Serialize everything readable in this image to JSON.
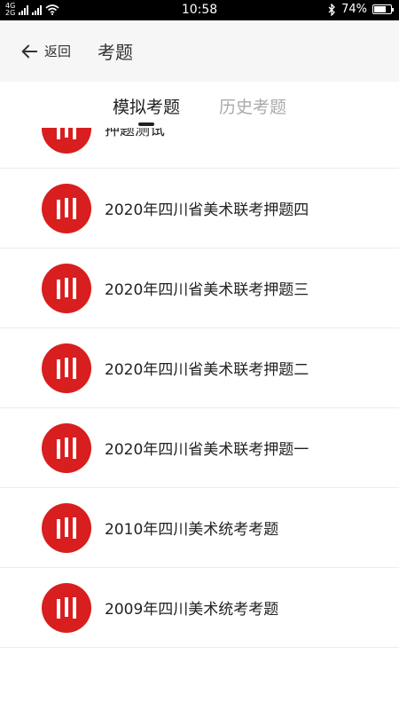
{
  "status": {
    "net_top": "4G",
    "net_bottom": "2G",
    "time": "10:58",
    "battery_text": "74%",
    "battery_level": 0.74
  },
  "header": {
    "back_label": "返回",
    "title": "考题"
  },
  "tabs": [
    {
      "label": "模拟考题",
      "active": true
    },
    {
      "label": "历史考题",
      "active": false
    }
  ],
  "list": {
    "items": [
      {
        "title": "押题测试"
      },
      {
        "title": "2020年四川省美术联考押题四"
      },
      {
        "title": "2020年四川省美术联考押题三"
      },
      {
        "title": "2020年四川省美术联考押题二"
      },
      {
        "title": "2020年四川省美术联考押题一"
      },
      {
        "title": "2010年四川美术统考考题"
      },
      {
        "title": "2009年四川美术统考考题"
      }
    ]
  },
  "colors": {
    "brand_red": "#d81e1e",
    "header_bg": "#f6f6f6",
    "tab_inactive": "#aaaaaa"
  },
  "icons": {
    "back": "arrow-left-icon",
    "item_logo": "sichuan-logo-icon"
  }
}
